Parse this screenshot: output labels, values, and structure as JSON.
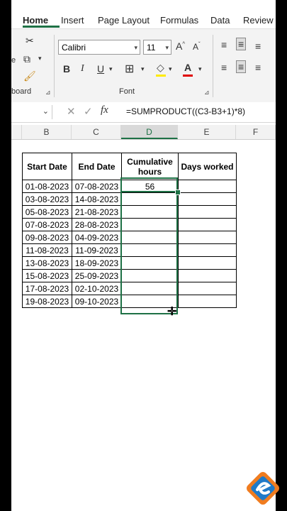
{
  "ribbon_tabs": [
    "Home",
    "Insert",
    "Page Layout",
    "Formulas",
    "Data",
    "Review"
  ],
  "clipboard_label": "board",
  "font_group_label": "Font",
  "font_name": "Calibri",
  "font_size": "11",
  "formula": "=SUMPRODUCT((C3-B3+1)*8)",
  "columns": [
    "B",
    "C",
    "D",
    "E",
    "F"
  ],
  "selected_column": "D",
  "table": {
    "headers": [
      "Start Date",
      "End Date",
      "Cumulative hours",
      "Days worked"
    ],
    "rows": [
      [
        "01-08-2023",
        "07-08-2023",
        "56",
        ""
      ],
      [
        "03-08-2023",
        "14-08-2023",
        "",
        ""
      ],
      [
        "05-08-2023",
        "21-08-2023",
        "",
        ""
      ],
      [
        "07-08-2023",
        "28-08-2023",
        "",
        ""
      ],
      [
        "09-08-2023",
        "04-09-2023",
        "",
        ""
      ],
      [
        "11-08-2023",
        "11-09-2023",
        "",
        ""
      ],
      [
        "13-08-2023",
        "18-09-2023",
        "",
        ""
      ],
      [
        "15-08-2023",
        "25-09-2023",
        "",
        ""
      ],
      [
        "17-08-2023",
        "02-10-2023",
        "",
        ""
      ],
      [
        "19-08-2023",
        "09-10-2023",
        "",
        ""
      ]
    ]
  },
  "colors": {
    "accent": "#1e7145",
    "logo_orange": "#f07c1f",
    "logo_blue": "#1f7ac8"
  }
}
